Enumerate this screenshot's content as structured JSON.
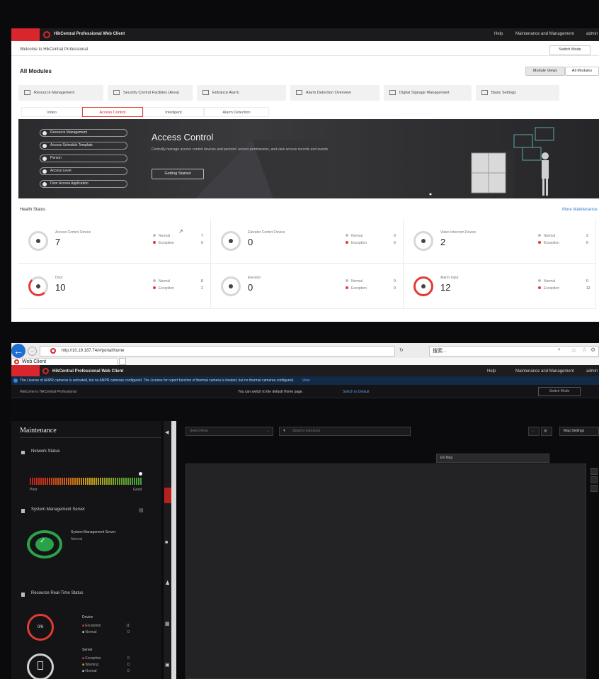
{
  "top_client": {
    "title": "HikCentral Professional Web Client",
    "titlebar_right": [
      "Help",
      "Maintenance and Management",
      "admin"
    ],
    "welcome": "Welcome to HikCentral Professional",
    "switch_mode": "Switch Mode",
    "section_title": "All Modules",
    "view_toggle": [
      "Module Views",
      "All Modules"
    ],
    "modules": [
      "Resource Management",
      "Security Control Facilities (Area)",
      "Entrance Alarm",
      "Alarm Detection Overview",
      "Digital Signage Management",
      "Basic Settings"
    ],
    "tabs": [
      "Video",
      "Access Control",
      "Intelligent",
      "Alarm Detection"
    ],
    "banner": {
      "title": "Access Control",
      "description": "Centrally manage access control devices and persons' access permissions, and view access records and events.",
      "cta": "Getting Started",
      "steps": [
        "Resource Management",
        "Access Schedule Template",
        "Person",
        "Access Level",
        "Door Access Application"
      ]
    },
    "health": {
      "title": "Health Status",
      "link": "More Maintenance",
      "normal_label": "Normal",
      "exception_label": "Exception",
      "tiles": [
        {
          "name": "Access Control Device",
          "count": "7",
          "normal": "7",
          "exception": "0"
        },
        {
          "name": "Elevator Control Device",
          "count": "0",
          "normal": "0",
          "exception": "0"
        },
        {
          "name": "Video Intercom Device",
          "count": "2",
          "normal": "2",
          "exception": "0"
        },
        {
          "name": "Door",
          "count": "10",
          "normal": "8",
          "exception": "2"
        },
        {
          "name": "Elevator",
          "count": "0",
          "normal": "0",
          "exception": "0"
        },
        {
          "name": "Alarm Input",
          "count": "12",
          "normal": "0",
          "exception": "12"
        }
      ]
    }
  },
  "bottom_client": {
    "browser": {
      "url": "http://10.19.187.74/#/portal/home",
      "search_text": "搜索...",
      "tab_label": "Web Client"
    },
    "title": "HikCentral Professional Web Client",
    "titlebar_right": [
      "Help",
      "Maintenance and Management",
      "admin"
    ],
    "notice": "The License of ANPR cameras is activated, but no ANPR cameras configured. The License for report function of thermal camera is treated, but no thermal cameras configured.",
    "notice_link": "View",
    "welcome": "Welcome to HikCentral Professional",
    "default_home": "You can switch to the default Home page.",
    "default_home_link": "Switch to Default",
    "switch_mode": "Switch Mode",
    "sidebar": {
      "title": "Maintenance",
      "network_status": "Network Status",
      "scale_low": "Poor",
      "scale_high": "Good",
      "server_section": "System Management Server",
      "server_name": "System Management Server",
      "server_status": "Normal",
      "resource_section": "Resource Real-Time Status",
      "device_group": "Device",
      "device_ratio": "0/6",
      "server_group": "Server",
      "legend_exception": "Exception",
      "legend_normal": "Normal",
      "legend_warning": "Warning",
      "device_exception": "11",
      "device_normal": "0",
      "server_exception": "0",
      "server_warning": "0",
      "server_normal": "0"
    },
    "toolbar": {
      "select_area": "Select Area",
      "search_placeholder": "Search resources",
      "map_settings": "Map Settings",
      "map_select": "E6 Map"
    }
  },
  "colors": {
    "brand_red": "#d8262c",
    "ok_green": "#2aa24a",
    "info_blue": "#1f6fd1"
  }
}
